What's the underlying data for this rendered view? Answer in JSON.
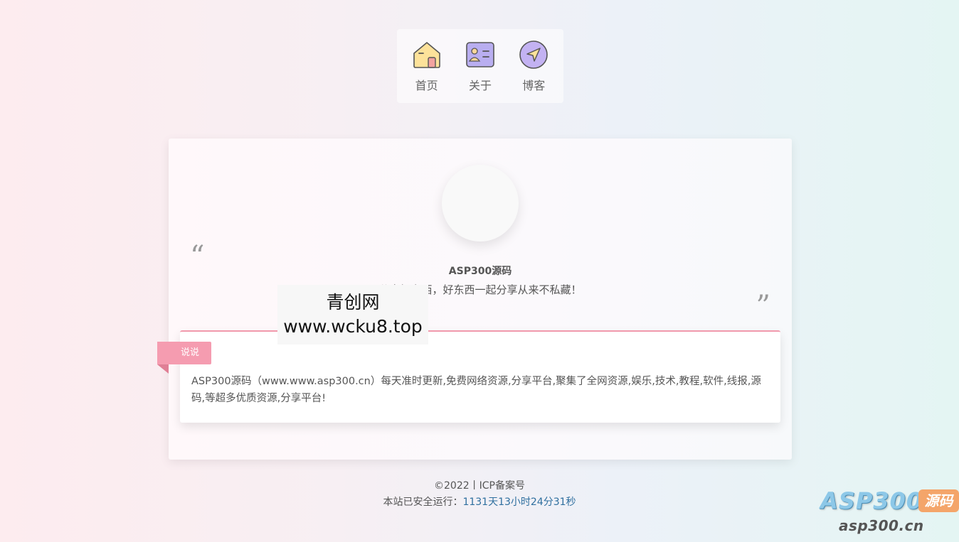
{
  "nav": {
    "items": [
      {
        "label": "首页",
        "icon": "home-icon"
      },
      {
        "label": "关于",
        "icon": "id-card-icon"
      },
      {
        "label": "博客",
        "icon": "navigation-arrow-icon"
      }
    ]
  },
  "profile": {
    "name": "ASP300源码",
    "motto": "分享好东西，好东西一起分享从来不私藏！"
  },
  "watermark": {
    "line1": "青创网",
    "line2": "www.wcku8.top"
  },
  "post": {
    "tag": "说说",
    "text": "ASP300源码（www.www.asp300.cn）每天准时更新,免费网络资源,分享平台,聚集了全网资源,娱乐,技术,教程,软件,线报,源码,等超多优质资源,分享平台!"
  },
  "footer": {
    "copyright": "©2022丨ICP备案号",
    "runtime_prefix": "本站已安全运行：",
    "runtime_value": "1131天13小时24分31秒"
  },
  "brand": {
    "name": "ASP300",
    "badge": "源码",
    "url": "asp300.cn"
  },
  "colors": {
    "accent_pink": "#f59cb0",
    "post_border": "#f199ac",
    "runtime_blue": "#2f6f9f",
    "brand_orange": "#f4a56a"
  }
}
